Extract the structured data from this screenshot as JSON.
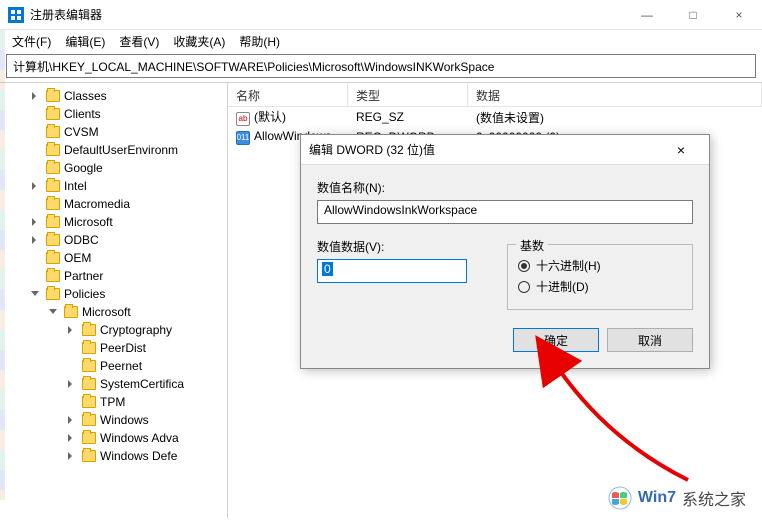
{
  "window": {
    "title": "注册表编辑器",
    "minimize": "—",
    "maximize": "□",
    "close": "×"
  },
  "menu": {
    "file": "文件(F)",
    "edit": "编辑(E)",
    "view": "查看(V)",
    "favorites": "收藏夹(A)",
    "help": "帮助(H)"
  },
  "address": "计算机\\HKEY_LOCAL_MACHINE\\SOFTWARE\\Policies\\Microsoft\\WindowsINKWorkSpace",
  "tree": {
    "items": [
      "Classes",
      "Clients",
      "CVSM",
      "DefaultUserEnvironm",
      "Google",
      "Intel",
      "Macromedia",
      "Microsoft",
      "ODBC",
      "OEM",
      "Partner"
    ],
    "policies": "Policies",
    "microsoft": "Microsoft",
    "subitems": [
      "Cryptography",
      "PeerDist",
      "Peernet",
      "SystemCertifica",
      "TPM",
      "Windows",
      "Windows Adva",
      "Windows Defe"
    ]
  },
  "list": {
    "headers": {
      "name": "名称",
      "type": "类型",
      "data": "数据"
    },
    "rows": [
      {
        "icon": "sz",
        "name": "(默认)",
        "type": "REG_SZ",
        "data": "(数值未设置)"
      },
      {
        "icon": "dw",
        "name": "AllowWindows",
        "type": "REG_DWORD",
        "data": "0x00000000 (0)"
      }
    ]
  },
  "dialog": {
    "title": "编辑 DWORD (32 位)值",
    "close": "×",
    "name_label": "数值名称(N):",
    "name_value": "AllowWindowsInkWorkspace",
    "data_label": "数值数据(V):",
    "data_value": "0",
    "base_label": "基数",
    "hex": "十六进制(H)",
    "dec": "十进制(D)",
    "ok": "确定",
    "cancel": "取消"
  },
  "watermark": {
    "text_a": "Win7",
    "text_b": "系统之家"
  }
}
